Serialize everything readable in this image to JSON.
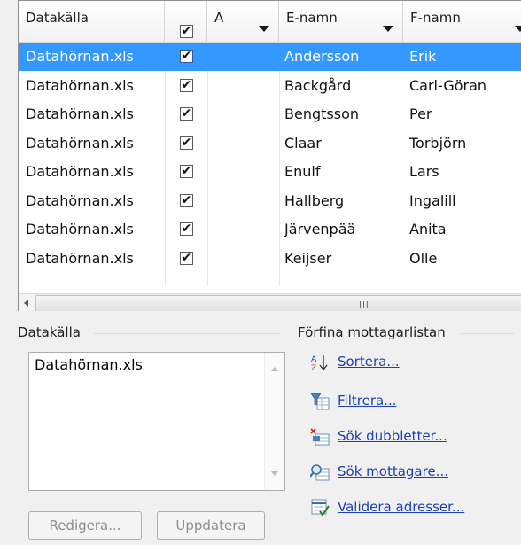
{
  "grid": {
    "columns": [
      {
        "label": "Datakälla"
      },
      {
        "label": ""
      },
      {
        "label": "A"
      },
      {
        "label": "E-namn"
      },
      {
        "label": "F-namn"
      }
    ],
    "header_checkbox": "✔",
    "rows": [
      {
        "source": "Datahörnan.xls",
        "check": "✔",
        "a": "",
        "last": "Andersson",
        "first": "Erik",
        "selected": true
      },
      {
        "source": "Datahörnan.xls",
        "check": "✔",
        "a": "",
        "last": "Backgård",
        "first": "Carl-Göran"
      },
      {
        "source": "Datahörnan.xls",
        "check": "✔",
        "a": "",
        "last": "Bengtsson",
        "first": "Per"
      },
      {
        "source": "Datahörnan.xls",
        "check": "✔",
        "a": "",
        "last": "Claar",
        "first": "Torbjörn"
      },
      {
        "source": "Datahörnan.xls",
        "check": "✔",
        "a": "",
        "last": "Enulf",
        "first": "Lars"
      },
      {
        "source": "Datahörnan.xls",
        "check": "✔",
        "a": "",
        "last": "Hallberg",
        "first": "Ingalill"
      },
      {
        "source": "Datahörnan.xls",
        "check": "✔",
        "a": "",
        "last": "Järvenpää",
        "first": "Anita"
      },
      {
        "source": "Datahörnan.xls",
        "check": "✔",
        "a": "",
        "last": "Keijser",
        "first": "Olle"
      }
    ],
    "scroll_grip": "III"
  },
  "datasource_panel": {
    "title": "Datakälla",
    "items": [
      "Datahörnan.xls"
    ],
    "edit_button": "Redigera...",
    "update_button": "Uppdatera"
  },
  "refine_panel": {
    "title": "Förfina mottagarlistan",
    "actions": [
      {
        "label": "Sortera...",
        "icon": "sort-icon"
      },
      {
        "label": "Filtrera...",
        "icon": "filter-icon"
      },
      {
        "label": "Sök dubbletter...",
        "icon": "find-duplicates-icon"
      },
      {
        "label": "Sök mottagare...",
        "icon": "find-recipient-icon"
      },
      {
        "label": "Validera adresser...",
        "icon": "validate-addresses-icon"
      }
    ]
  },
  "colors": {
    "selection": "#3399ff",
    "link": "#1a3fb8"
  }
}
